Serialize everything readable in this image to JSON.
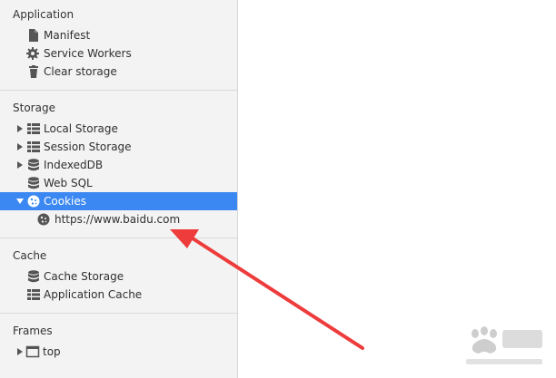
{
  "sections": {
    "application": {
      "title": "Application",
      "items": [
        {
          "label": "Manifest",
          "icon": "document-icon"
        },
        {
          "label": "Service Workers",
          "icon": "gear-icon"
        },
        {
          "label": "Clear storage",
          "icon": "trash-icon"
        }
      ]
    },
    "storage": {
      "title": "Storage",
      "items": [
        {
          "label": "Local Storage",
          "icon": "table-grid-icon",
          "expanded": false
        },
        {
          "label": "Session Storage",
          "icon": "table-grid-icon",
          "expanded": false
        },
        {
          "label": "IndexedDB",
          "icon": "database-icon",
          "expanded": false
        },
        {
          "label": "Web SQL",
          "icon": "database-icon"
        },
        {
          "label": "Cookies",
          "icon": "cookie-icon",
          "expanded": true,
          "selected": true
        },
        {
          "label": "https://www.baidu.com",
          "icon": "cookie-icon"
        }
      ]
    },
    "cache": {
      "title": "Cache",
      "items": [
        {
          "label": "Cache Storage",
          "icon": "database-icon"
        },
        {
          "label": "Application Cache",
          "icon": "table-grid-icon"
        }
      ]
    },
    "frames": {
      "title": "Frames",
      "items": [
        {
          "label": "top",
          "icon": "frame-window-icon",
          "expanded": false
        }
      ]
    }
  },
  "colors": {
    "selection": "#3b88f2",
    "annotation_arrow": "#ee3b3b",
    "sidebar_bg": "#f3f3f3"
  }
}
